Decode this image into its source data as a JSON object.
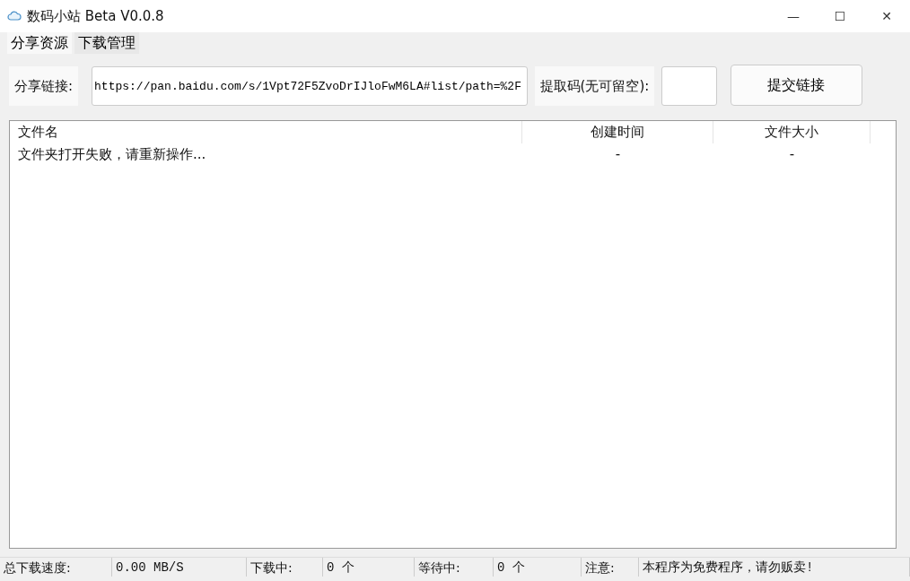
{
  "window": {
    "title": "数码小站 Beta V0.0.8",
    "controls": [
      "—",
      "☐",
      "✕"
    ]
  },
  "tabs": [
    {
      "label": "分享资源",
      "selected": true
    },
    {
      "label": "下载管理",
      "selected": false
    }
  ],
  "share_form": {
    "link_label": "分享链接:",
    "link_value": "https://pan.baidu.com/s/1Vpt72F5ZvoDrIJloFwM6LA#list/path=%2F",
    "code_label": "提取码(无可留空):",
    "submit_button": "提交链接"
  },
  "table": {
    "columns": [
      "文件名",
      "创建时间",
      "文件大小"
    ],
    "rows": [
      [
        "文件夹打开失败，请重新操作...",
        "-",
        "-"
      ]
    ]
  },
  "status_bar": [
    {
      "label": "总下载速度:",
      "value": "0.00 MB/S"
    },
    {
      "label": "下载中:",
      "value": "0 个"
    },
    {
      "label": "等待中:",
      "value": "0 个"
    },
    {
      "label": "注意:",
      "value": "本程序为免费程序，请勿贩卖!"
    }
  ]
}
